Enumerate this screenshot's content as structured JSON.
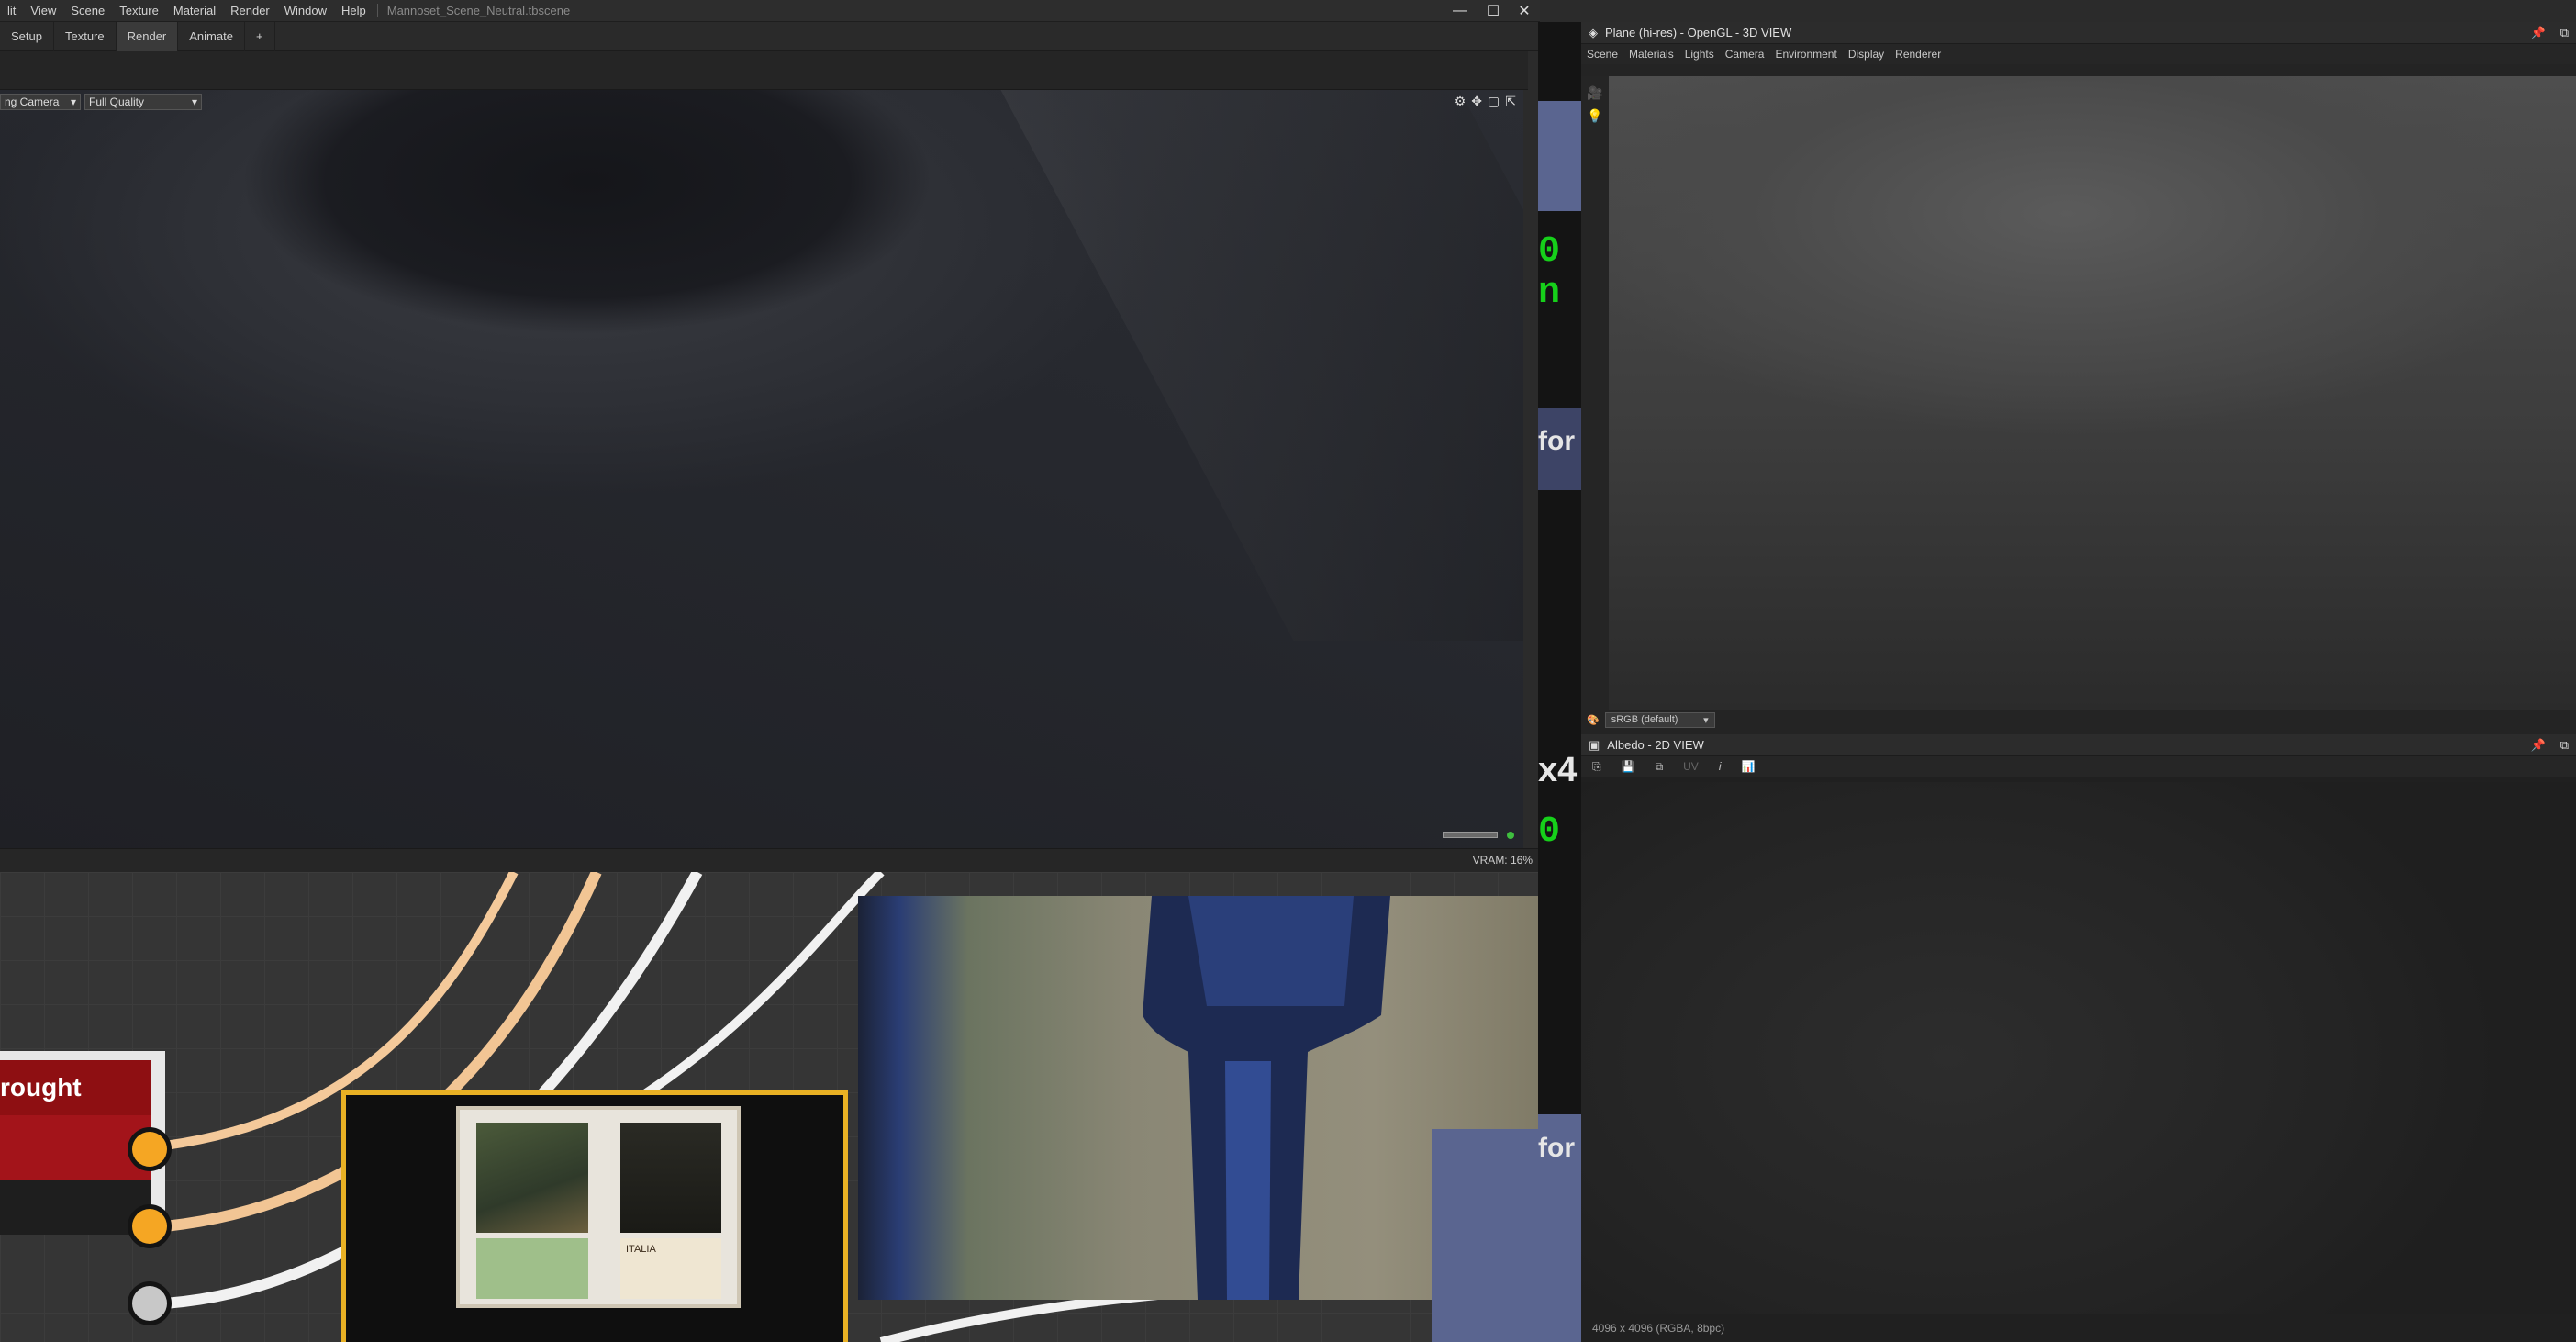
{
  "app": {
    "menu": [
      "lit",
      "View",
      "Scene",
      "Texture",
      "Material",
      "Render",
      "Window",
      "Help"
    ],
    "file_title": "Mannoset_Scene_Neutral.tbscene",
    "window_controls": {
      "minimize": "—",
      "maximize": "☐",
      "close": "✕"
    }
  },
  "tabs": [
    {
      "label": "Setup",
      "active": false
    },
    {
      "label": "Texture",
      "active": false
    },
    {
      "label": "Render",
      "active": true
    },
    {
      "label": "Animate",
      "active": false
    },
    {
      "label": "+",
      "active": false
    }
  ],
  "viewport": {
    "camera_select": "ng Camera",
    "quality_select": "Full Quality",
    "icons": [
      "gear-icon",
      "move-icon",
      "frame-icon",
      "popout-icon"
    ],
    "vram": "VRAM: 16%"
  },
  "mid_strip": {
    "green_texts": [
      "0 n",
      "0"
    ],
    "white_texts": [
      "for",
      "x4",
      "for"
    ]
  },
  "view3d": {
    "title": "Plane (hi-res) - OpenGL - 3D VIEW",
    "menu": [
      "Scene",
      "Materials",
      "Lights",
      "Camera",
      "Environment",
      "Display",
      "Renderer"
    ],
    "colorspace": "sRGB (default)"
  },
  "view2d": {
    "title": "Albedo - 2D VIEW",
    "uv_label": "UV",
    "info_icon": "i",
    "status": "4096 x 4096 (RGBA, 8bpc)"
  },
  "nodes": {
    "red_node_title": "rought",
    "port_colors": [
      "#f5a623",
      "#f5a623",
      "#c8c8c8"
    ],
    "stamp_text": "ITALIA"
  },
  "colors": {
    "accent_green": "#16d01a",
    "node_red": "#8e0f12",
    "node_gold_border": "#e9b124",
    "node_blue": "#5a6590"
  }
}
